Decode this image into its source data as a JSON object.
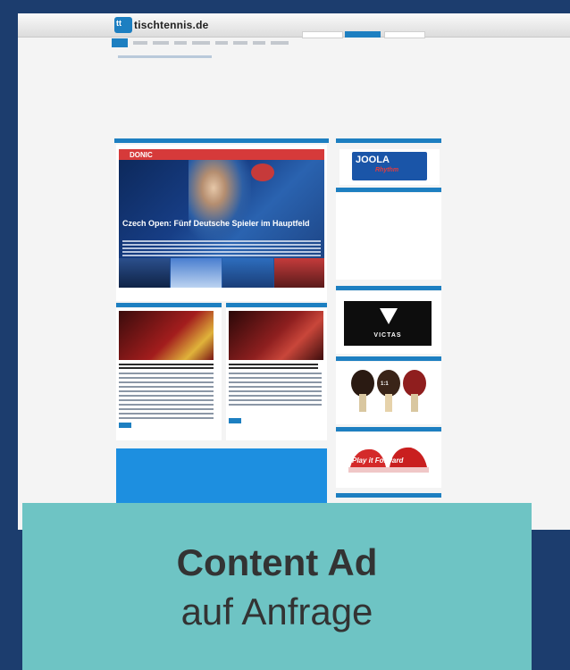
{
  "site": {
    "logo_icon": "tt",
    "logo_text": "tischtennis.de",
    "photo_banner": "DONIC",
    "headline": "Czech Open: Fünf Deutsche Spieler im Hauptfeld",
    "rackets_label": "1:1",
    "victas_label": "VICTAS",
    "joola_label": "JOOLA",
    "joola_sub": "Rhythm",
    "shoes_label": "Play it Forward"
  },
  "ad": {
    "title": "Content Ad",
    "subtitle": "auf Anfrage"
  },
  "colors": {
    "background": "#1c3d6e",
    "overlay": "#6ec4c4",
    "accent": "#1d7fc1"
  }
}
